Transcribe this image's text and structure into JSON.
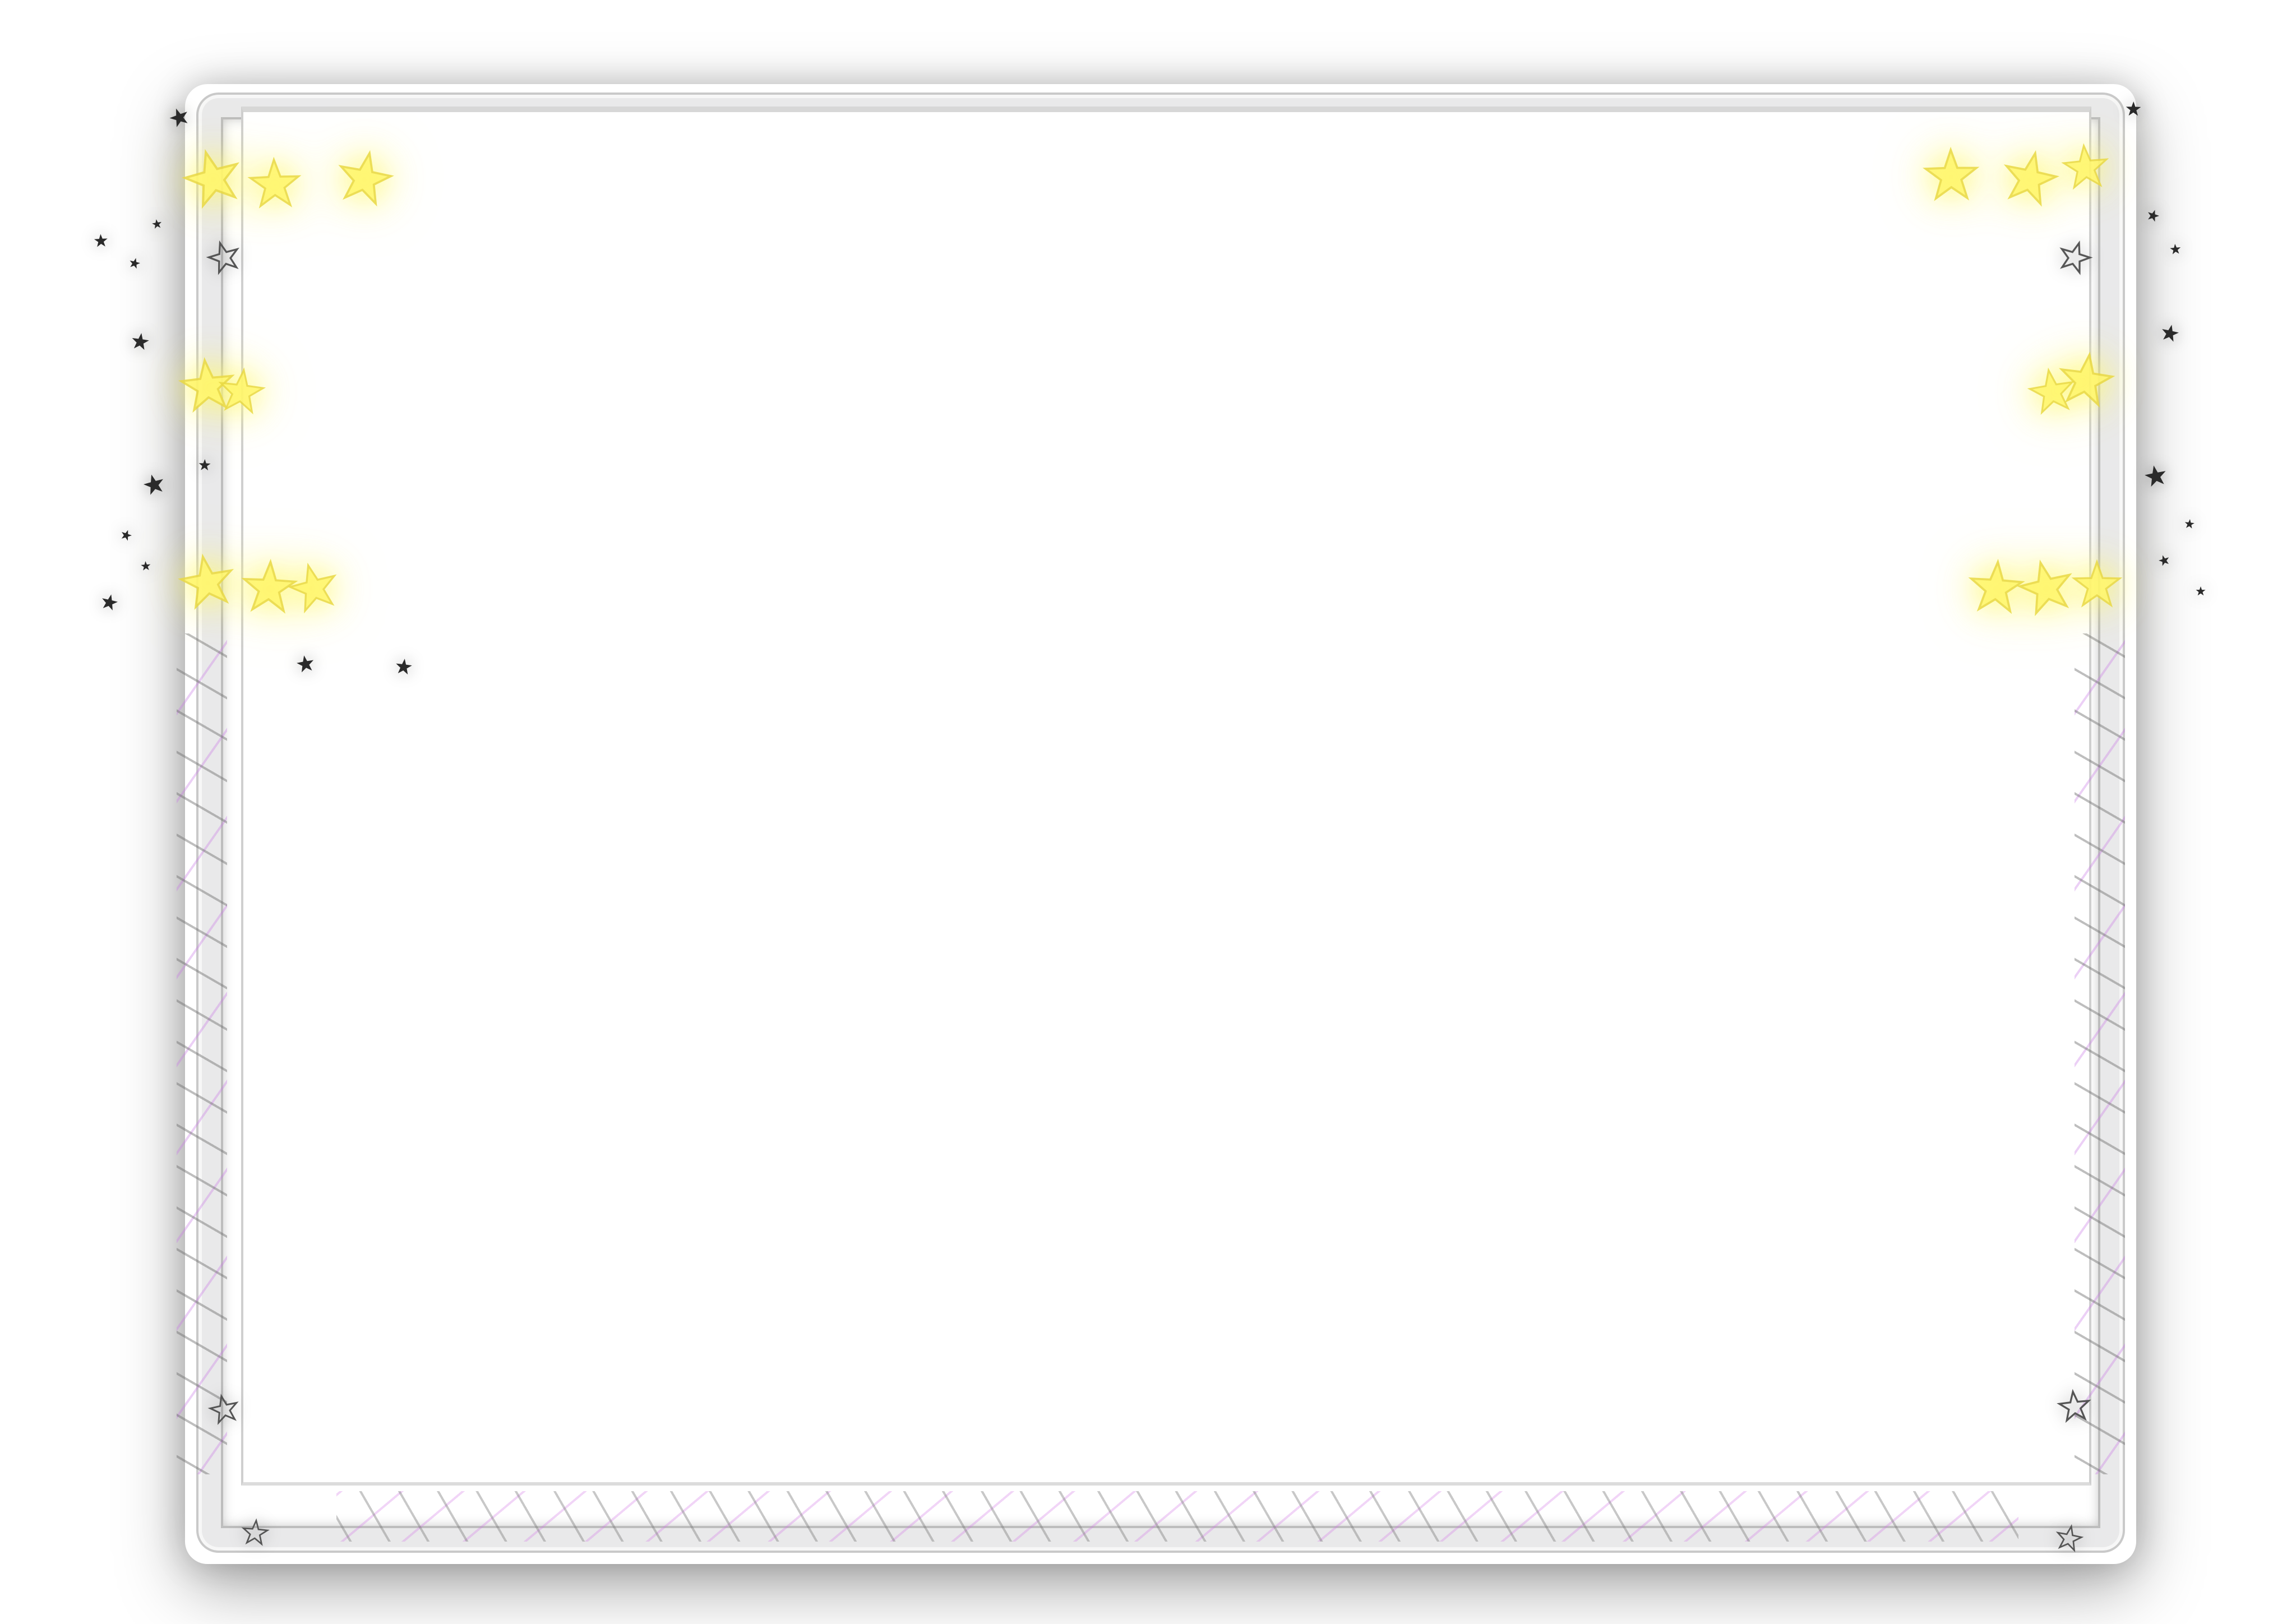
{
  "frame": {
    "colors": {
      "border": "#e9e9ea",
      "panel": "#ffffff",
      "star_glow": "#fff66a",
      "dark_star": "#2a2a2a",
      "accent_purple": "#c86be0"
    }
  },
  "decorations": {
    "yellow_star_cluster_icon": "star-icon",
    "dark_star_icon": "star-icon"
  }
}
